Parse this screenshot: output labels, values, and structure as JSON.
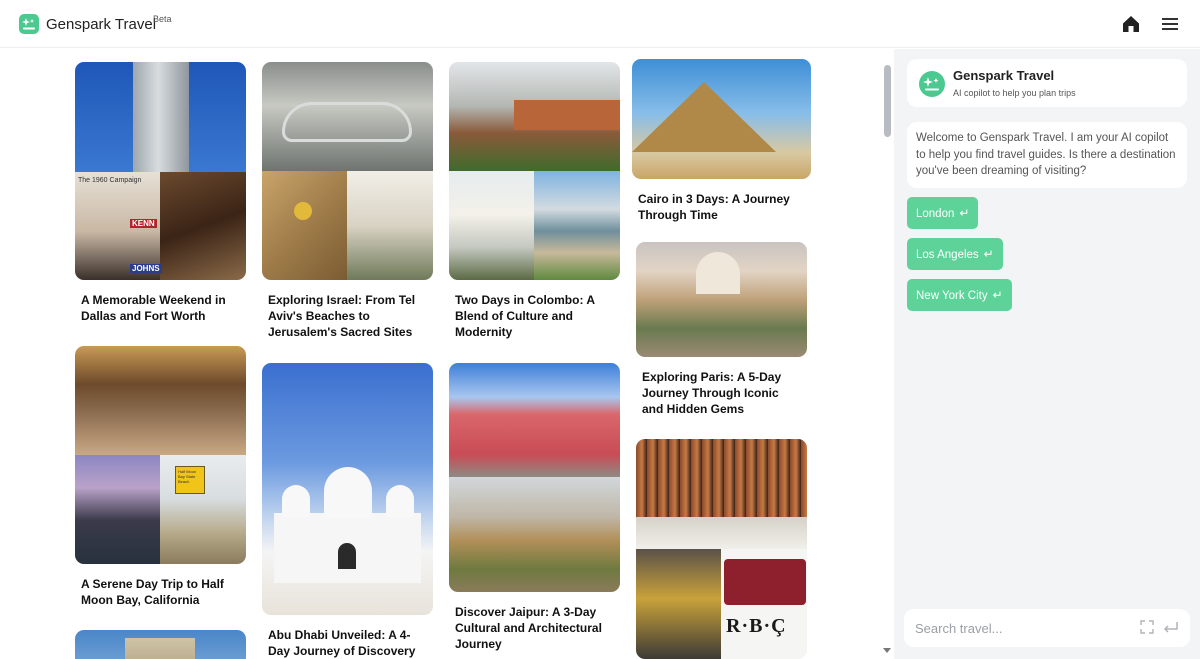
{
  "header": {
    "brand": "Genspark Travel",
    "beta": "Beta",
    "icons": {
      "logo": "sparkle-logo-icon",
      "home": "home-icon",
      "menu": "hamburger-menu-icon"
    }
  },
  "feed": {
    "cards": [
      {
        "title": "A Memorable Weekend in Dallas and Fort Worth"
      },
      {
        "title": "A Serene Day Trip to Half Moon Bay, California"
      },
      {
        "title": "Exploring Israel: From Tel Aviv's Beaches to Jerusalem's Sacred Sites"
      },
      {
        "title": "Abu Dhabi Unveiled: A 4-Day Journey of Discovery"
      },
      {
        "title": "Two Days in Colombo: A Blend of Culture and Modernity"
      },
      {
        "title": "Discover Jaipur: A 3-Day Cultural and Architectural Journey"
      },
      {
        "title": "Cairo in 3 Days: A Journey Through Time"
      },
      {
        "title": "Exploring Paris: A 5-Day Journey Through Iconic and Hidden Gems"
      }
    ],
    "photo_text": {
      "dallas_poster": "The 1960 Campaign",
      "dallas_sign1": "KENN",
      "dallas_sign2": "JOHNS",
      "hmb_sign": "Half Moon Bay State Beach",
      "rbc_text": "R·B·Ç"
    }
  },
  "chat": {
    "copilot_title": "Genspark Travel",
    "copilot_subtitle": "AI copilot to help you plan trips",
    "welcome": "Welcome to Genspark Travel. I am your AI copilot to help you find travel guides. Is there a destination you've been dreaming of visiting?",
    "suggestions": [
      {
        "label": "London"
      },
      {
        "label": "Los Angeles"
      },
      {
        "label": "New York City"
      }
    ],
    "return_glyph": "↵",
    "search_placeholder": "Search travel...",
    "icons": {
      "expand": "expand-icon",
      "send": "send-return-icon"
    }
  },
  "colors": {
    "accent": "#4cc990",
    "chip": "#5dd39a",
    "panel_bg": "#f3f4f6"
  }
}
